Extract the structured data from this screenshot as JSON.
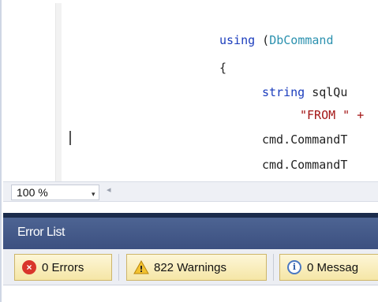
{
  "editor": {
    "lines": [
      {
        "parts": [
          {
            "t": "using",
            "c": "kw"
          },
          {
            "t": " (",
            "c": "plain"
          },
          {
            "t": "DbCommand",
            "c": "type"
          }
        ]
      },
      {
        "parts": [
          {
            "t": "{",
            "c": "plain"
          }
        ]
      },
      {
        "parts": [
          {
            "t": "string",
            "c": "kw"
          },
          {
            "t": " sqlQu",
            "c": "plain"
          }
        ]
      },
      {
        "parts": [
          {
            "t": "\"FROM \" +",
            "c": "str"
          }
        ]
      },
      {
        "parts": [
          {
            "t": "cmd.CommandT",
            "c": "plain"
          }
        ]
      },
      {
        "parts": [
          {
            "t": "cmd.CommandT",
            "c": "plain"
          }
        ]
      }
    ]
  },
  "zoom": {
    "value": "100 %",
    "arrow": "▾",
    "scroll_left_arrow": "◂"
  },
  "error_list": {
    "title": "Error List",
    "errors_label": "0 Errors",
    "warnings_label": "822 Warnings",
    "messages_label": "0 Messag",
    "error_icon_glyph": "×",
    "warning_icon_glyph": "!",
    "info_icon_glyph": "i"
  },
  "colors": {
    "keyword": "#1b3dbd",
    "type": "#2b91af",
    "string": "#a31515",
    "panel_header": "#4d6493"
  }
}
